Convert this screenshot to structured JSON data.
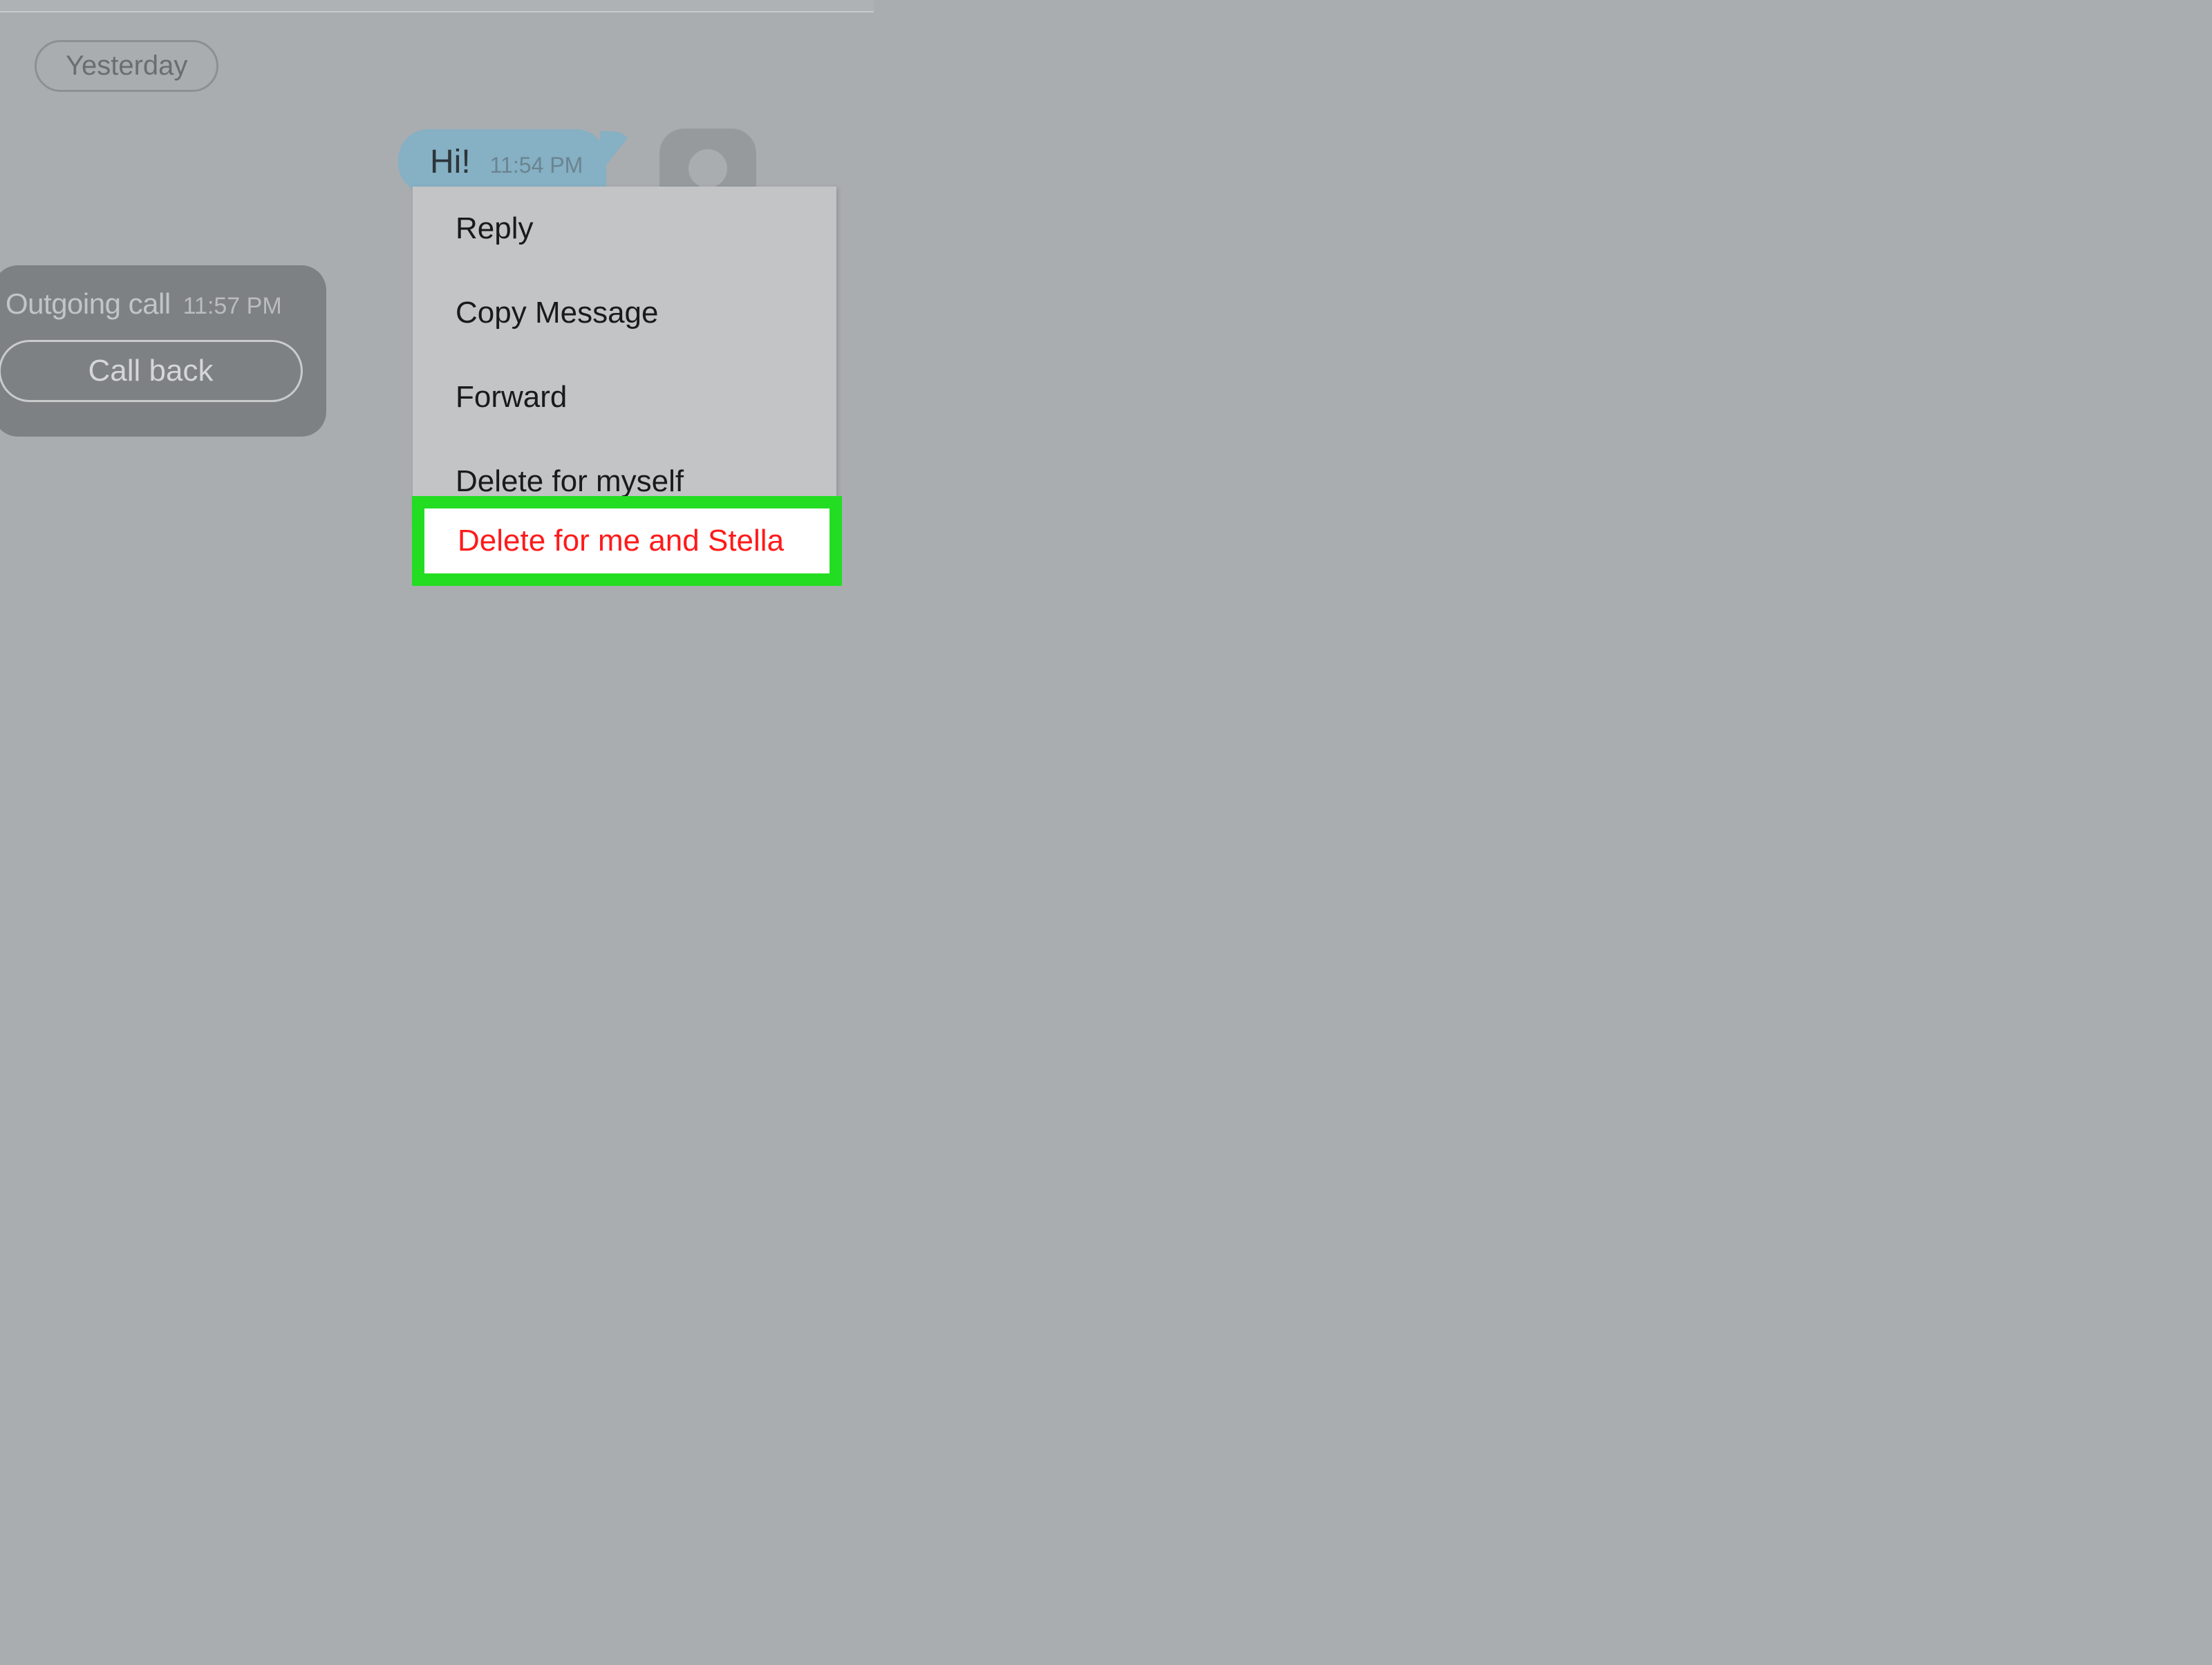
{
  "date_separator": "Yesterday",
  "call": {
    "label": "Outgoing call",
    "time": "11:57 PM",
    "callback_button": "Call back"
  },
  "message": {
    "text": "Hi!",
    "time": "11:54 PM"
  },
  "context_menu": {
    "reply": "Reply",
    "copy": "Copy Message",
    "forward": "Forward",
    "delete_self": "Delete for myself",
    "delete_both": "Delete for me and Stella"
  }
}
